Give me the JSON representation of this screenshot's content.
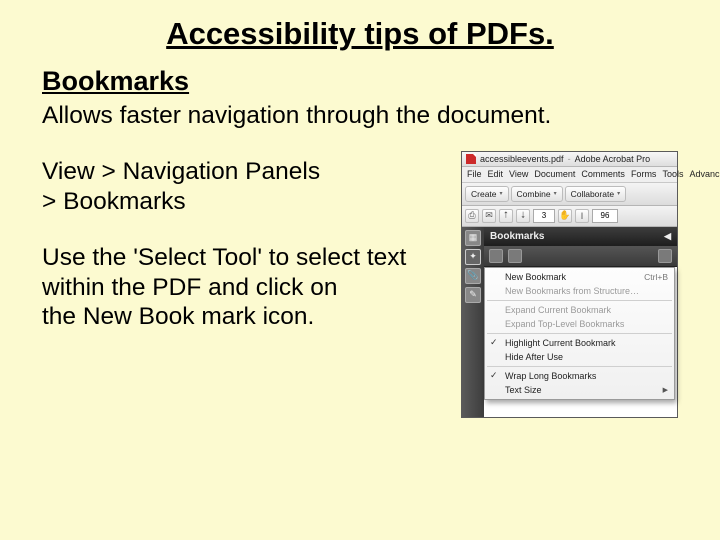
{
  "title": "Accessibility tips of PDFs.",
  "subheading": "Bookmarks",
  "intro": "Allows faster navigation through the document.",
  "nav_path": "View > Navigation Panels\n > Bookmarks",
  "instruction": "Use the 'Select Tool'  to select text within the PDF and click on\n the New Book mark icon.",
  "acrobat": {
    "title_file": "accessibleevents.pdf",
    "app_name": "Adobe Acrobat Pro",
    "menubar": [
      "File",
      "Edit",
      "View",
      "Document",
      "Comments",
      "Forms",
      "Tools",
      "Advanc"
    ],
    "toolbar": {
      "create": "Create",
      "combine": "Combine",
      "collaborate": "Collaborate",
      "page_num": "3",
      "zoom": "96"
    },
    "panel_title": "Bookmarks",
    "popup": {
      "new_bookmark": "New Bookmark",
      "new_bookmark_shortcut": "Ctrl+B",
      "from_structure": "New Bookmarks from Structure…",
      "expand": "Expand Current Bookmark",
      "expand_top": "Expand Top-Level Bookmarks",
      "highlight": "Highlight Current Bookmark",
      "hide": "Hide After Use",
      "wrap": "Wrap Long Bookmarks",
      "text_size": "Text Size"
    }
  }
}
